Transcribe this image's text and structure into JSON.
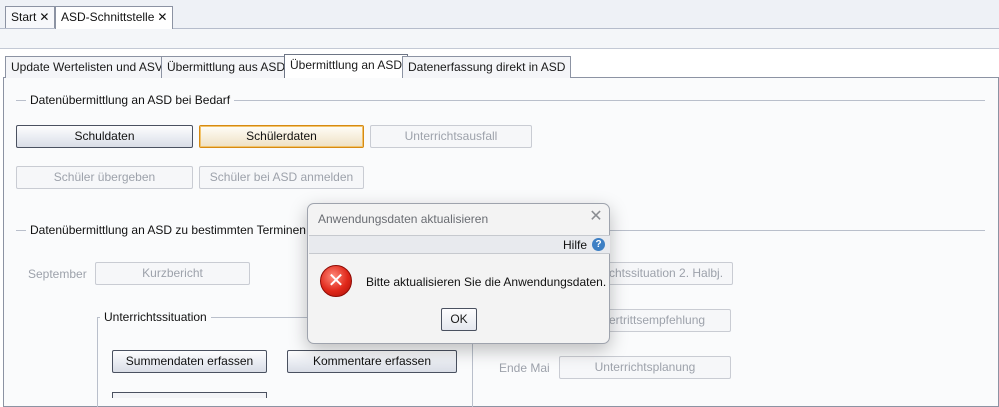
{
  "top_tabs": [
    {
      "label": "Start",
      "close": "✕"
    },
    {
      "label": "ASD-Schnittstelle",
      "close": "✕"
    }
  ],
  "inner_tabs": [
    "Update Wertelisten und ASV",
    "Übermittlung aus ASD",
    "Übermittlung an ASD",
    "Datenerfassung direkt in ASD"
  ],
  "section_bedarf": {
    "title": "Datenübermittlung an ASD bei Bedarf",
    "buttons": [
      "Schuldaten",
      "Schülerdaten",
      "Unterrichtsausfall",
      "Schüler übergeben",
      "Schüler bei ASD anmelden"
    ]
  },
  "section_termine": {
    "title": "Datenübermittlung an ASD zu bestimmten Terminen",
    "september_label": "September",
    "kurzbericht": "Kurzbericht",
    "right_button_1": "chtssituation 2. Halbj.",
    "right_button_2": "ertrittsempfehlung",
    "ende_mai_label": "Ende Mai",
    "unterrichtsplanung": "Unterrichtsplanung",
    "unterrichtssituation": {
      "title": "Unterrichtssituation",
      "summendaten": "Summendaten erfassen",
      "kommentare": "Kommentare erfassen"
    }
  },
  "dialog": {
    "title": "Anwendungsdaten aktualisieren",
    "close": "✕",
    "help": "Hilfe",
    "help_icon": "?",
    "error_icon": "✕",
    "message": "Bitte aktualisieren Sie die Anwendungsdaten.",
    "ok": "OK"
  }
}
